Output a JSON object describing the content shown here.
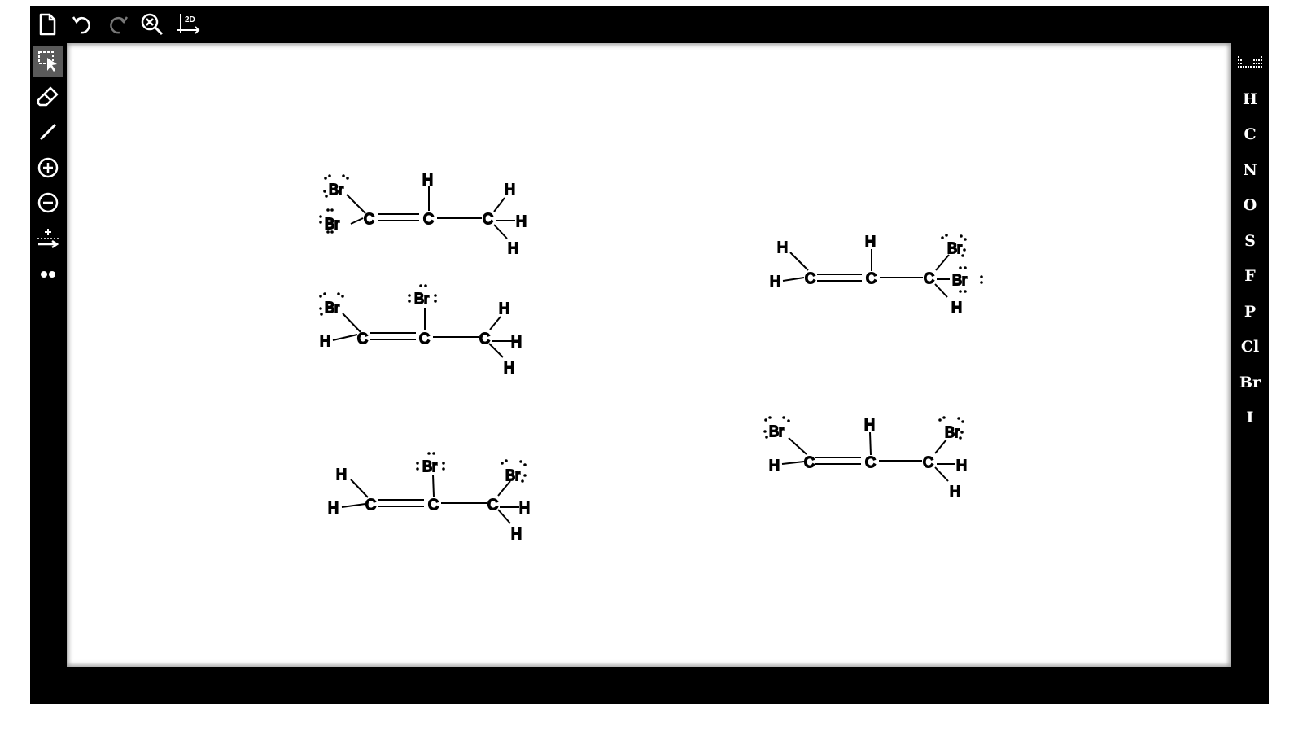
{
  "toolbar": {
    "new_icon": "new-document-icon",
    "undo_icon": "undo-icon",
    "redo_icon": "redo-icon",
    "clear_icon": "clear-zoom-icon",
    "cleanup_label": "2D"
  },
  "left_tools": [
    {
      "name": "select-tool",
      "icon": "select-arrow-icon"
    },
    {
      "name": "eraser-tool",
      "icon": "eraser-icon"
    },
    {
      "name": "bond-tool",
      "icon": "line-icon"
    },
    {
      "name": "positive-charge-tool",
      "icon": "plus-circle-icon"
    },
    {
      "name": "negative-charge-tool",
      "icon": "minus-circle-icon"
    },
    {
      "name": "reaction-arrow-tool",
      "icon": "arrow-icon"
    },
    {
      "name": "lone-pair-tool",
      "icon": "dots-icon"
    }
  ],
  "elements": {
    "periodic_icon": "periodic-table-icon",
    "list": [
      "H",
      "C",
      "N",
      "O",
      "S",
      "F",
      "P",
      "Cl",
      "Br",
      "I"
    ]
  },
  "atoms": {
    "H": "H",
    "C": "C",
    "Br": "Br"
  }
}
